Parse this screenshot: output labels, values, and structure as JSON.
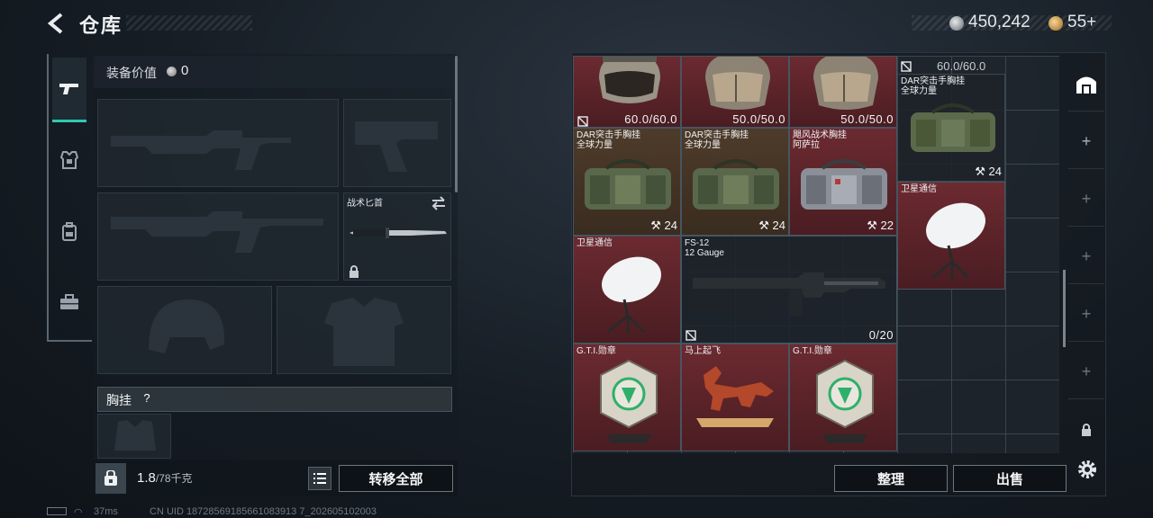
{
  "header": {
    "title": "仓库",
    "silver": "450,242",
    "gold": "55+"
  },
  "left_tabs": [
    {
      "name": "weapons",
      "active": true
    },
    {
      "name": "armor",
      "active": false
    },
    {
      "name": "backpack",
      "active": false
    },
    {
      "name": "case",
      "active": false
    }
  ],
  "equipment": {
    "value_label": "装备价值",
    "value": "0",
    "knife_label": "战术匕首",
    "chest_label": "胸挂",
    "chest_help": "?"
  },
  "footer_left": {
    "weight": "1.8",
    "weight_max": "/78千克",
    "transfer_all": "转移全部"
  },
  "grid_items": {
    "helmet1_val": "60.0/60.0",
    "helmet2_val": "50.0/50.0",
    "helmet3_val": "50.0/50.0",
    "helmet4_val": "60.0/60.0",
    "bag1_name": "DAR突击手胸挂",
    "bag1_sub": "全球力量",
    "bag1_count": "24",
    "bag2_name": "DAR突击手胸挂",
    "bag2_sub": "全球力量",
    "bag2_count": "24",
    "bag3_name": "DAR突击手胸挂",
    "bag3_sub": "全球力量",
    "bag3_count": "24",
    "bag4_name": "飓风战术胸挂",
    "bag4_sub": "阿萨拉",
    "bag4_count": "22",
    "sat1_name": "卫星通信",
    "sat2_name": "卫星通信",
    "gun_name": "FS-12",
    "gun_sub": "12 Gauge",
    "gun_ammo": "0/20",
    "medal1_name": "G.T.I.勋章",
    "horse_name": "马上起飞",
    "medal2_name": "G.T.I.勋章"
  },
  "footer_right": {
    "sort": "整理",
    "sell": "出售"
  },
  "status_bar": {
    "ping": "37ms",
    "uid": "CN UID 18728569185661083913 7_202605102003"
  },
  "colors": {
    "accent": "#2fc9b0",
    "item_red": "#6b2a30",
    "item_brown": "#4e3b2a"
  }
}
